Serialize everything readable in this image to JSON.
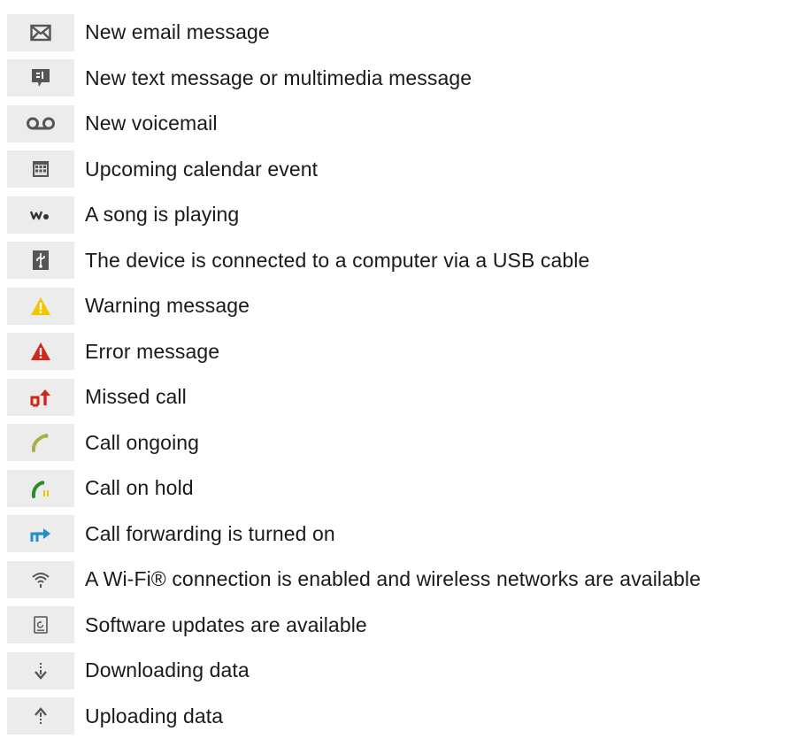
{
  "rows": [
    {
      "icon": "email-icon",
      "label": "New email message"
    },
    {
      "icon": "text-message-icon",
      "label": "New text message or multimedia message"
    },
    {
      "icon": "voicemail-icon",
      "label": "New voicemail"
    },
    {
      "icon": "calendar-icon",
      "label": "Upcoming calendar event"
    },
    {
      "icon": "walkman-icon",
      "label": "A song is playing"
    },
    {
      "icon": "usb-icon",
      "label": "The device is connected to a computer via a USB cable"
    },
    {
      "icon": "warning-icon",
      "label": "Warning message"
    },
    {
      "icon": "error-icon",
      "label": "Error message"
    },
    {
      "icon": "missed-call-icon",
      "label": "Missed call"
    },
    {
      "icon": "call-ongoing-icon",
      "label": "Call ongoing"
    },
    {
      "icon": "call-on-hold-icon",
      "label": "Call on hold"
    },
    {
      "icon": "call-forwarding-icon",
      "label": "Call forwarding is turned on"
    },
    {
      "icon": "wifi-icon",
      "label": "A Wi-Fi® connection is enabled and wireless networks are available"
    },
    {
      "icon": "software-update-icon",
      "label": "Software updates are available"
    },
    {
      "icon": "download-icon",
      "label": "Downloading data"
    },
    {
      "icon": "upload-icon",
      "label": "Uploading data"
    }
  ],
  "colors": {
    "icon_background": "#ececec",
    "icon_gray": "#555555",
    "warning_yellow": "#f5c400",
    "error_red": "#d0261c",
    "call_olive": "#a8b04a",
    "call_green": "#2f8a2a",
    "forward_blue": "#1f8fd0"
  }
}
